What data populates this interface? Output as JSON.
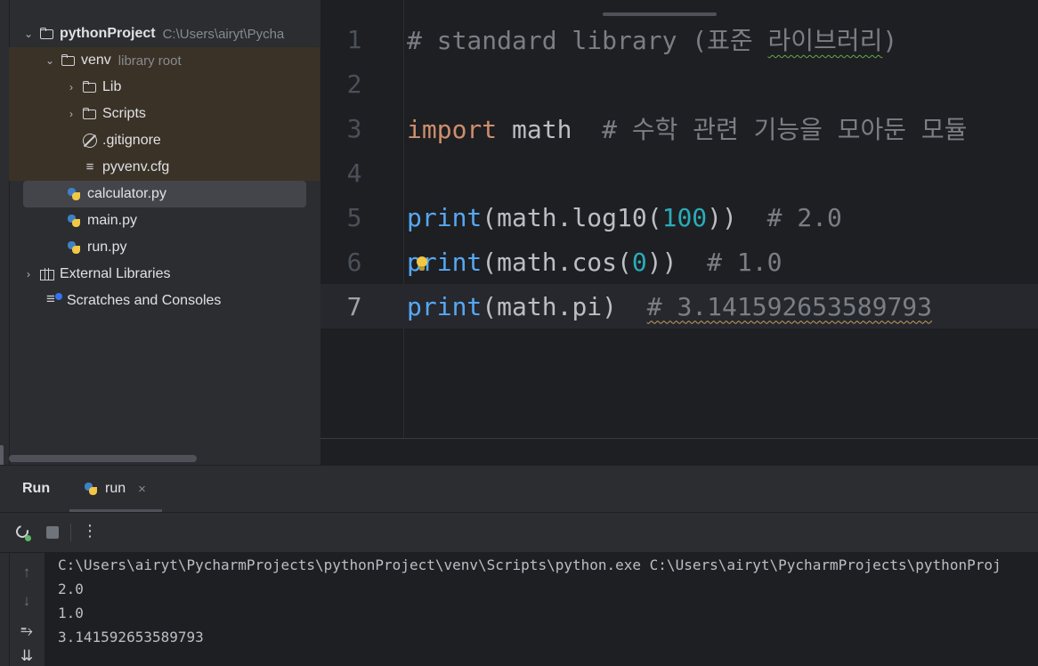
{
  "project_tree": {
    "root": {
      "name": "pythonProject",
      "path": "C:\\Users\\airyt\\Pycha"
    },
    "venv": {
      "name": "venv",
      "tag": "library root"
    },
    "lib": "Lib",
    "scripts": "Scripts",
    "gitignore": ".gitignore",
    "pyvenv": "pyvenv.cfg",
    "files": [
      "calculator.py",
      "main.py",
      "run.py"
    ],
    "external": "External Libraries",
    "scratches": "Scratches and Consoles"
  },
  "editor": {
    "current_line": 7,
    "lines": [
      {
        "n": "1",
        "comment": "# standard library (표준 ",
        "comment_squig": "라이브러리",
        "comment_end": ")"
      },
      {
        "n": "2"
      },
      {
        "n": "3",
        "keyword": "import",
        "module": " math",
        "comment": "  # 수학 관련 기능을 모아둔 모듈"
      },
      {
        "n": "4"
      },
      {
        "n": "5",
        "func": "print",
        "open": "(math.log10(",
        "num": "100",
        "close": "))",
        "comment": "  # 2.0"
      },
      {
        "n": "6",
        "func": "print",
        "open": "(math.cos(",
        "num": "0",
        "close": "))",
        "comment": "  # 1.0"
      },
      {
        "n": "7",
        "func": "print",
        "open": "(math.pi)",
        "comment_lead": "  ",
        "comment": "# 3.141592653589793"
      }
    ]
  },
  "run_panel": {
    "title": "Run",
    "tab_label": "run",
    "close_glyph": "×",
    "more_glyph": "⋮",
    "side_icons": {
      "up": "↑",
      "down": "↓",
      "wrap": "⥱",
      "scroll_end": "⇊"
    },
    "output": [
      "C:\\Users\\airyt\\PycharmProjects\\pythonProject\\venv\\Scripts\\python.exe C:\\Users\\airyt\\PycharmProjects\\pythonProj",
      "2.0",
      "1.0",
      "3.141592653589793"
    ]
  },
  "colors": {
    "keyword": "#cf8e6d",
    "function": "#56a8f5",
    "number": "#2aacb8",
    "comment": "#7a7e85",
    "excluded_bg": "#3b3227"
  }
}
